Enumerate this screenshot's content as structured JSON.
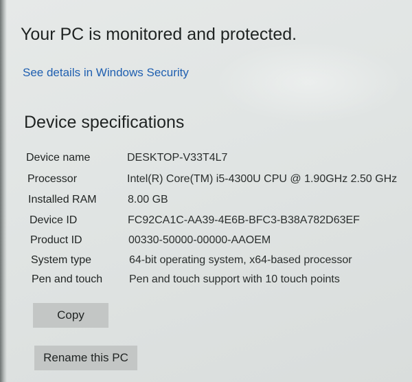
{
  "status_message": "Your PC is monitored and protected.",
  "security_link": "See details in Windows Security",
  "section_title": "Device specifications",
  "specs": [
    {
      "label": "Device name",
      "value": "DESKTOP-V33T4L7"
    },
    {
      "label": "Processor",
      "value": "Intel(R) Core(TM) i5-4300U CPU @ 1.90GHz   2.50 GHz"
    },
    {
      "label": "Installed RAM",
      "value": "8.00 GB"
    },
    {
      "label": "Device ID",
      "value": "FC92CA1C-AA39-4E6B-BFC3-B38A782D63EF"
    },
    {
      "label": "Product ID",
      "value": "00330-50000-00000-AAOEM"
    },
    {
      "label": "System type",
      "value": "64-bit operating system, x64-based processor"
    },
    {
      "label": "Pen and touch",
      "value": "Pen and touch support with 10 touch points"
    }
  ],
  "buttons": {
    "copy": "Copy",
    "rename": "Rename this PC"
  },
  "colors": {
    "link": "#1f5fb0",
    "button_bg": "#c3c6c5",
    "background": "#e1e5e4"
  }
}
